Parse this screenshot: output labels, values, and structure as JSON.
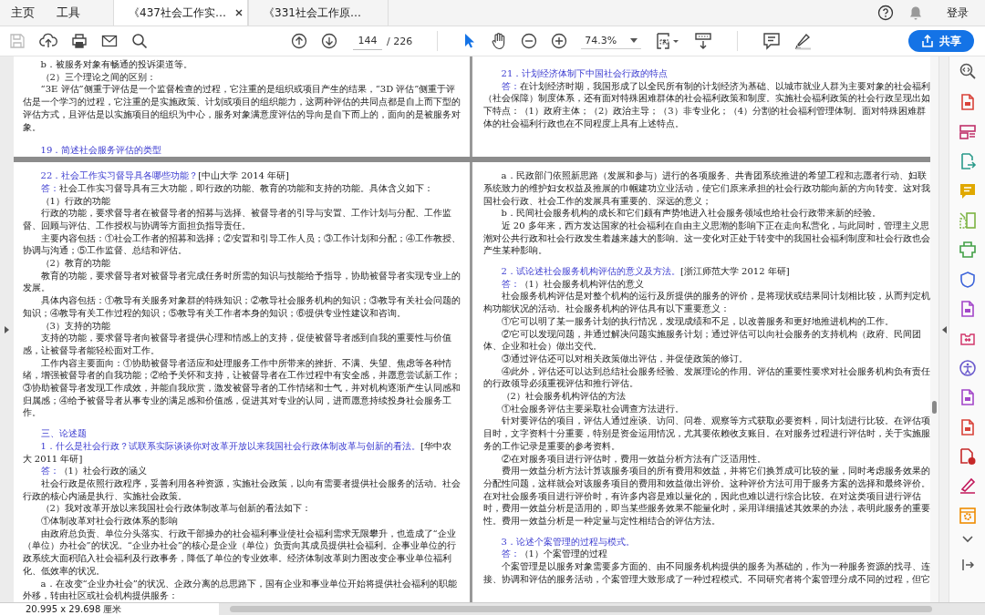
{
  "tabs": [
    {
      "kind": "nav",
      "label": "主页",
      "selected": false
    },
    {
      "kind": "nav",
      "label": "工具",
      "selected": false
    },
    {
      "kind": "document",
      "label": "《437社会工作实…",
      "selected": true
    },
    {
      "kind": "document",
      "label": "《331社会工作原…",
      "selected": false
    }
  ],
  "header": {
    "sign_in": "登录"
  },
  "toolbar": {
    "save": {
      "disabled": true
    },
    "page_number": "144",
    "page_total": "/ 226",
    "zoom": "74.3%",
    "share": "共享",
    "tools": [
      {
        "kind": "select",
        "selected": true
      },
      {
        "kind": "pan",
        "selected": false
      }
    ]
  },
  "spreads": [
    {
      "pages": [
        {
          "paragraphs": [
            {
              "kind": "body",
              "text": "b．被服务对象有畅通的投诉渠道等。"
            },
            {
              "kind": "body",
              "text": "（2）三个理论之间的区别："
            },
            {
              "kind": "body",
              "text": "“3E 评估”侧重于评估是一个监督检查的过程，它注重的是组织或项目产生的结果，“3D 评估”侧重于评估是一个学习的过程，它注重的是实施政策、计划或项目的组织能力，这两种评估的共同点都是自上而下型的评估方式，且评估是以实施项目的组织为中心，服务对象满意度评估的导向是自下而上的，面向的是被服务对象。"
            },
            {
              "kind": "question",
              "text": "19．简述社会服务评估的类型"
            }
          ]
        },
        {
          "paragraphs": [
            {
              "kind": "question",
              "text": "21．计划经济体制下中国社会行政的特点"
            },
            {
              "kind": "answer",
              "prefix": "答：",
              "text": "在计划经济时期，我国形成了以全民所有制的计划经济为基础、以城市就业人群为主要对象的社会福利（社会保障）制度体系，还有面对特殊困难群体的社会福利政策和制度。实施社会福利政策的社会行政呈现出如下特点：（1）政府主体；（2）政治主导；（3）非专业化；（4）分割的社会福利管理体制。面对特殊困难群体的社会福利行政也在不同程度上具有上述特点。"
            }
          ]
        }
      ]
    },
    {
      "pages": [
        {
          "paragraphs": [
            {
              "kind": "question",
              "text": "22．社会工作实习督导具各哪些功能？",
              "source": "[中山大学 2014 年研]"
            },
            {
              "kind": "answer",
              "prefix": "答：",
              "text": "社会工作实习督导具有三大功能，即行政的功能、教育的功能和支持的功能。具体含义如下："
            },
            {
              "kind": "body",
              "text": "（1）行政的功能"
            },
            {
              "kind": "body",
              "text": "行政的功能，要求督导者在被督导者的招募与选择、被督导者的引导与安置、工作计划与分配、工作监督、回顾与评估、工作授权与协调等方面担负指导责任。"
            },
            {
              "kind": "body",
              "text": "主要内容包括：①社会工作者的招募和选择；②安置和引导工作人员；③工作计划和分配；④工作教授、协调与沟通；⑤工作监督、总结和评估。"
            },
            {
              "kind": "body",
              "text": "（2）教育的功能"
            },
            {
              "kind": "body",
              "text": "教育的功能，要求督导者对被督导者完成任务时所需的知识与技能给予指导，协助被督导者实现专业上的发展。"
            },
            {
              "kind": "body",
              "text": "具体内容包括：①教导有关服务对象群的特殊知识；②教导社会服务机构的知识；③教导有关社会问题的知识；④教导有关工作过程的知识；⑤教导有关工作者本身的知识；⑥提供专业性建议和咨询。"
            },
            {
              "kind": "body",
              "text": "（3）支持的功能"
            },
            {
              "kind": "body",
              "text": "支持的功能，要求督导者向被督导者提供心理和情感上的支持，促使被督导者感到自我的重要性与价值感，让被督导者能轻松面对工作。"
            },
            {
              "kind": "body",
              "text": "工作内容主要面向：①协助被督导者适应和处理服务工作中所带来的挫折、不满、失望、焦虑等各种情绪，增强被督导者的自我功能；②给予关怀和支持，让被督导者在工作过程中有安全感，并愿意尝试新工作；③协助被督导者发现工作成效，并能自我欣赏，激发被督导者的工作情绪和士气，并对机构逐渐产生认同感和归属感；④给予被督导者从事专业的满足感和价值感，促进其对专业的认同，进而愿意持续投身社会服务工作。"
            },
            {
              "kind": "section",
              "text": "三、论述题"
            },
            {
              "kind": "question",
              "text": "1．什么是社会行政？试联系实际谈谈你对改革开放以来我国社会行政体制改革与创新的看法。",
              "source": "[华中农大 2011 年研]"
            },
            {
              "kind": "answer",
              "prefix": "答：",
              "text": "（1）社会行政的涵义"
            },
            {
              "kind": "body",
              "text": "社会行政是依照行政程序，妥善利用各种资源，实施社会政策，以向有需要者提供社会服务的活动。社会行政的核心内涵是执行、实施社会政策。"
            },
            {
              "kind": "body",
              "text": "（2）我对改革开放以来我国社会行政体制改革与创新的看法如下："
            },
            {
              "kind": "body",
              "text": "①体制改革对社会行政体系的影响"
            },
            {
              "kind": "body",
              "text": "由政府总负责、单位分头落实、行政干部操办的社会福利事业使社会福利需求无限攀升，也造成了“企业（单位）办社会”的状况。“企业办社会”的核心是企业（单位）负责向其成员提供社会福利。企事业单位的行政系统大面积陷入社会福利及行政事务，降低了单位的专业效率。经济体制改革则力图改变企事业单位福利化、低效率的状况。"
            },
            {
              "kind": "body",
              "text": "a．在改变“企业办社会”的状况、企政分离的总思路下，国有企业和事业单位开始将提供社会福利的职能外移，转由社区或社会机构提供服务："
            }
          ]
        },
        {
          "paragraphs": [
            {
              "kind": "body",
              "text": "a．民政部门依照新思路（发展和参与）进行的各项服务、共青团系统推进的希望工程和志愿者行动、妇联系统致力的维护妇女权益及推展的巾帼建功立业活动，使它们原来承担的社会行政功能向新的方向转变。这对我国社会行政、社会工作的发展具有重要的、深远的意义；"
            },
            {
              "kind": "body",
              "text": "b．民间社会服务机构的成长和它们颇有声势地进入社会服务领域也给社会行政带来新的经验。"
            },
            {
              "kind": "body",
              "text": "近 20 多年来，西方发达国家的社会福利在自由主义思潮的影响下正在走向私营化，与此同时，管理主义思潮对公共行政和社会行政发生着越来越大的影响。这一变化对正处于转变中的我国社会福利制度和社会行政也会产生某种影响。"
            },
            {
              "kind": "question",
              "text": "2．试论述社会服务机构评估的意义及方法。",
              "source": "[浙江师范大学 2012 年研]"
            },
            {
              "kind": "answer",
              "prefix": "答：",
              "text": "（1）社会服务机构评估的意义"
            },
            {
              "kind": "body",
              "text": "社会服务机构评估是对整个机构的运行及所提供的服务的评价，是将现状或结果同计划相比较，从而判定机构功能状况的活动。社会服务机构的评估具有以下重要意义："
            },
            {
              "kind": "body",
              "text": "①它可以明了某一服务计划的执行情况，发现成绩和不足，以改善服务和更好地推进机构的工作。"
            },
            {
              "kind": "body",
              "text": "②它可以发现问题，并通过解决问题实施服务计划；通过评估可以向社会服务的支持机构（政府、民间团体、企业和社会）做出交代。"
            },
            {
              "kind": "body",
              "text": "③通过评估还可以对相关政策做出评估，并促使政策的修订。"
            },
            {
              "kind": "body",
              "text": "④此外，评估还可以达到总结社会服务经验、发展理论的作用。评估的重要性要求对社会服务机构负有责任的行政领导必须重视评估和推行评估。"
            },
            {
              "kind": "body",
              "text": "（2）社会服务机构评估的方法"
            },
            {
              "kind": "body",
              "text": "①社会服务评估主要采取社会调查方法进行。"
            },
            {
              "kind": "body",
              "text": "针对要评估的项目，评估人通过座谈、访问、问卷、观察等方式获取必要资料，同计划进行比较。在评估项目时，文字资料十分重要，特别是资金运用情况，尤其要依赖收支账目。在对服务过程进行评估时，关于实施服务的工作记录是重要的参考资料。"
            },
            {
              "kind": "body",
              "text": "②在对服务项目进行评估时，费用一效益分析方法有广泛适用性。"
            },
            {
              "kind": "body",
              "text": "费用一效益分析方法计算该服务项目的所有费用和效益，并将它们换算成可比较的量，同时考虑服务效果的分配性问题，这样就会对该服务项目的费用和效益做出评价。这种评价方法可用于服务方案的选择和最终评价。在对社会服务项目进行评价时，有许多内容是难以量化的，因此也难以进行综合比较。在对这类项目进行评估时，费用一效益分析是适用的，即当某些服务效果不能量化时，采用详细描述其效果的办法，表明此服务的重要性。费用一效益分析是一种定量与定性相结合的评估方法。"
            },
            {
              "kind": "question",
              "text": "3．论述个案管理的过程与模式。"
            },
            {
              "kind": "answer",
              "prefix": "答：",
              "text": "（1）个案管理的过程"
            },
            {
              "kind": "body",
              "text": "个案管理是以服务对象需要多方面的、由不同服务机构提供的服务为基础的，作为一种服务资源的找寻、连接、协调和评估的服务活动，个案管理大致形成了一种过程模式。不同研究者将个案管理分成不同的过程，但它"
            }
          ]
        }
      ]
    }
  ],
  "status_bar": {
    "page_size": "20.995 x 29.698 厘米"
  }
}
